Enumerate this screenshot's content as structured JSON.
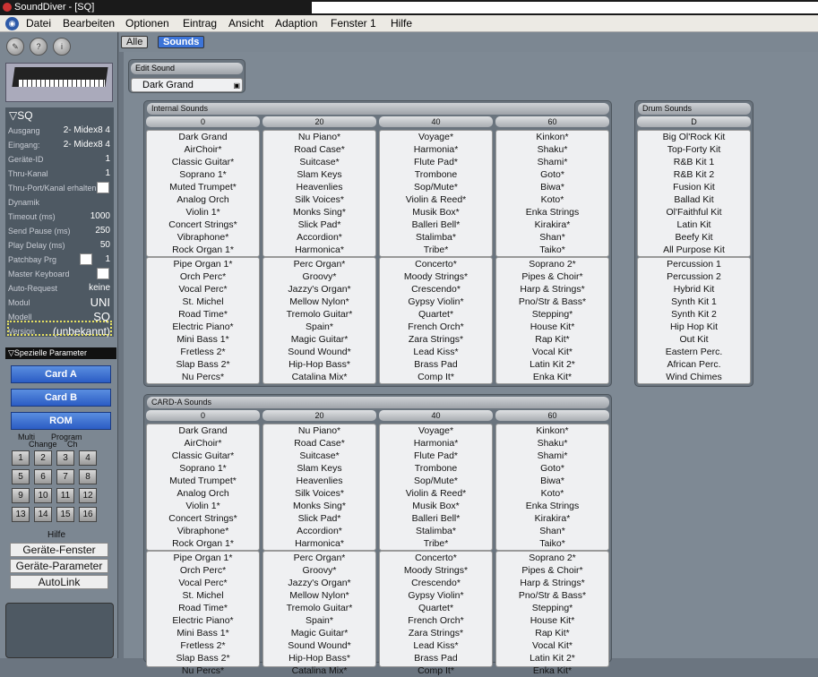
{
  "window": {
    "title": "SoundDiver - [SQ]"
  },
  "menu": [
    "Datei",
    "Bearbeiten",
    "Optionen",
    "Eintrag",
    "Ansicht",
    "Adaption",
    "Fenster 1",
    "Hilfe"
  ],
  "device": {
    "name": "SQ",
    "params": [
      {
        "label": "Ausgang",
        "value": "2- Midex8 4"
      },
      {
        "label": "Eingang:",
        "value": "2- Midex8 4"
      },
      {
        "label": "Geräte-ID",
        "value": "1"
      },
      {
        "label": "Thru-Kanal",
        "value": "1"
      },
      {
        "label": "Thru-Port/Kanal erhalten",
        "value": ""
      },
      {
        "label": "Dynamik",
        "value": ""
      },
      {
        "label": "Timeout (ms)",
        "value": "1000"
      },
      {
        "label": "Send Pause (ms)",
        "value": "250"
      },
      {
        "label": "Play Delay (ms)",
        "value": "50"
      },
      {
        "label": "Patchbay Prg",
        "value": "1"
      },
      {
        "label": "Master Keyboard",
        "value": ""
      },
      {
        "label": "Auto-Request",
        "value": "keine"
      },
      {
        "label": "Modul",
        "value": "UNI"
      },
      {
        "label": "Modell",
        "value": "SQ"
      },
      {
        "label": "Version",
        "value": "(unbekannt)"
      }
    ]
  },
  "special": {
    "header": "Spezielle Parameter",
    "buttons": [
      "Card A",
      "Card B",
      "ROM"
    ],
    "multi": "Multi",
    "change": "Change",
    "program": "Program",
    "ch": "Ch",
    "numbers": [
      "1",
      "2",
      "3",
      "4",
      "5",
      "6",
      "7",
      "8",
      "9",
      "10",
      "11",
      "12",
      "13",
      "14",
      "15",
      "16"
    ],
    "hilfe": "Hilfe",
    "help_buttons": [
      "Geräte-Fenster",
      "Geräte-Parameter",
      "AutoLink"
    ]
  },
  "tabs": [
    "Alle",
    "Sounds"
  ],
  "edit_sound": {
    "title": "Edit Sound",
    "value": "Dark Grand"
  },
  "internal": {
    "title": "Internal Sounds",
    "cols": [
      "0",
      "20",
      "40",
      "60"
    ],
    "c0": [
      "Dark Grand",
      "AirChoir*",
      "Classic Guitar*",
      "Soprano 1*",
      "Muted Trumpet*",
      "Analog Orch",
      "Violin 1*",
      "Concert Strings*",
      "Vibraphone*",
      "Rock Organ 1*",
      "Pipe Organ 1*",
      "Orch Perc*",
      "Vocal Perc*",
      "St. Michel",
      "Road Time*",
      "Electric Piano*",
      "Mini Bass 1*",
      "Fretless 2*",
      "Slap Bass 2*",
      "Nu Percs*"
    ],
    "c1": [
      "Nu Piano*",
      "Road Case*",
      "Suitcase*",
      "Slam Keys",
      "Heavenlies",
      "Silk Voices*",
      "Monks Sing*",
      "Slick Pad*",
      "Accordion*",
      "Harmonica*",
      "Perc Organ*",
      "Groovy*",
      "Jazzy's Organ*",
      "Mellow Nylon*",
      "Tremolo Guitar*",
      "Spain*",
      "Magic Guitar*",
      "Sound Wound*",
      "Hip-Hop Bass*",
      "Catalina Mix*"
    ],
    "c2": [
      "Voyage*",
      "Harmonia*",
      "Flute Pad*",
      "Trombone",
      "Sop/Mute*",
      "Violin & Reed*",
      "Musik Box*",
      "Balleri Bell*",
      "Stalimba*",
      "Tribe*",
      "Concerto*",
      "Moody Strings*",
      "Crescendo*",
      "Gypsy Violin*",
      "Quartet*",
      "French Orch*",
      "Zara Strings*",
      "Lead Kiss*",
      "Brass Pad",
      "Comp It*"
    ],
    "c3": [
      "Kinkon*",
      "Shaku*",
      "Shami*",
      "Goto*",
      "Biwa*",
      "Koto*",
      "Enka Strings",
      "Kirakira*",
      "Shan*",
      "Taiko*",
      "Soprano 2*",
      "Pipes & Choir*",
      "Harp & Strings*",
      "Pno/Str & Bass*",
      "Stepping*",
      "House Kit*",
      "Rap Kit*",
      "Vocal Kit*",
      "Latin Kit 2*",
      "Enka Kit*"
    ]
  },
  "drum": {
    "title": "Drum Sounds",
    "col": "D",
    "items": [
      "Big Ol'Rock Kit",
      "Top-Forty Kit",
      "R&B Kit 1",
      "R&B Kit 2",
      "Fusion Kit",
      "Ballad Kit",
      "Ol'Faithful Kit",
      "Latin Kit",
      "Beefy Kit",
      "All Purpose Kit",
      "Percussion 1",
      "Percussion 2",
      "Hybrid Kit",
      "Synth Kit 1",
      "Synth Kit 2",
      "Hip Hop Kit",
      "Out Kit",
      "Eastern Perc.",
      "African Perc.",
      "Wind Chimes"
    ]
  },
  "card": {
    "title": "CARD-A Sounds",
    "cols": [
      "0",
      "20",
      "40",
      "60"
    ]
  }
}
